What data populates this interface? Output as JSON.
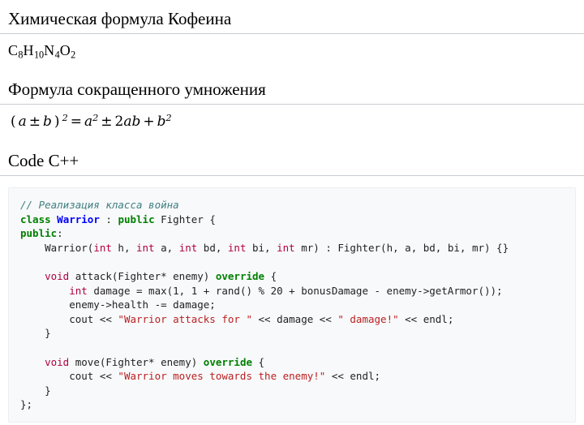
{
  "sections": {
    "chem": {
      "heading": "Химическая формула Кофеина",
      "formula_plain": "C8H10N4O2",
      "formula_parts": [
        {
          "sym": "C",
          "sub": "8"
        },
        {
          "sym": "H",
          "sub": "10"
        },
        {
          "sym": "N",
          "sub": "4"
        },
        {
          "sym": "O",
          "sub": "2"
        }
      ]
    },
    "math": {
      "heading": "Формула сокращенного умножения",
      "formula_plain": "(a ± b)² = a² ± 2ab + b²",
      "lhs_open": "(",
      "lhs_a": "a",
      "lhs_op": "±",
      "lhs_b": "b",
      "lhs_close": ")",
      "lhs_pow": "2",
      "equals": "=",
      "r_a": "a",
      "r_a_pow": "2",
      "r_op1": "±",
      "r_coef": "2",
      "r_ab": "ab",
      "r_op2": "+",
      "r_b": "b",
      "r_b_pow": "2"
    },
    "code": {
      "heading": "Code C++",
      "language": "cpp",
      "lines": [
        [
          {
            "t": "c",
            "v": "// Реализация класса война"
          }
        ],
        [
          {
            "t": "k",
            "v": "class"
          },
          {
            "t": "n",
            "v": " "
          },
          {
            "t": "nc",
            "v": "Warrior"
          },
          {
            "t": "n",
            "v": " : "
          },
          {
            "t": "k",
            "v": "public"
          },
          {
            "t": "n",
            "v": " Fighter {"
          }
        ],
        [
          {
            "t": "k",
            "v": "public"
          },
          {
            "t": "n",
            "v": ":"
          }
        ],
        [
          {
            "t": "n",
            "v": "    Warrior("
          },
          {
            "t": "kt",
            "v": "int"
          },
          {
            "t": "n",
            "v": " h, "
          },
          {
            "t": "kt",
            "v": "int"
          },
          {
            "t": "n",
            "v": " a, "
          },
          {
            "t": "kt",
            "v": "int"
          },
          {
            "t": "n",
            "v": " bd, "
          },
          {
            "t": "kt",
            "v": "int"
          },
          {
            "t": "n",
            "v": " bi, "
          },
          {
            "t": "kt",
            "v": "int"
          },
          {
            "t": "n",
            "v": " mr) : Fighter(h, a, bd, bi, mr) {}"
          }
        ],
        [
          {
            "t": "n",
            "v": ""
          }
        ],
        [
          {
            "t": "n",
            "v": "    "
          },
          {
            "t": "kt",
            "v": "void"
          },
          {
            "t": "n",
            "v": " attack(Fighter* enemy) "
          },
          {
            "t": "k",
            "v": "override"
          },
          {
            "t": "n",
            "v": " {"
          }
        ],
        [
          {
            "t": "n",
            "v": "        "
          },
          {
            "t": "kt",
            "v": "int"
          },
          {
            "t": "n",
            "v": " damage = max(1, 1 + rand() % 20 + bonusDamage - enemy->getArmor());"
          }
        ],
        [
          {
            "t": "n",
            "v": "        enemy->health -= damage;"
          }
        ],
        [
          {
            "t": "n",
            "v": "        cout << "
          },
          {
            "t": "s",
            "v": "\"Warrior attacks for \""
          },
          {
            "t": "n",
            "v": " << damage << "
          },
          {
            "t": "s",
            "v": "\" damage!\""
          },
          {
            "t": "n",
            "v": " << endl;"
          }
        ],
        [
          {
            "t": "n",
            "v": "    }"
          }
        ],
        [
          {
            "t": "n",
            "v": ""
          }
        ],
        [
          {
            "t": "n",
            "v": "    "
          },
          {
            "t": "kt",
            "v": "void"
          },
          {
            "t": "n",
            "v": " move(Fighter* enemy) "
          },
          {
            "t": "k",
            "v": "override"
          },
          {
            "t": "n",
            "v": " {"
          }
        ],
        [
          {
            "t": "n",
            "v": "        cout << "
          },
          {
            "t": "s",
            "v": "\"Warrior moves towards the enemy!\""
          },
          {
            "t": "n",
            "v": " << endl;"
          }
        ],
        [
          {
            "t": "n",
            "v": "    }"
          }
        ],
        [
          {
            "t": "n",
            "v": "};"
          }
        ]
      ]
    }
  },
  "colors": {
    "text": "#202122",
    "heading_rule": "#c8ccd1",
    "code_bg": "#f8f9fb",
    "code_border": "#eceef1",
    "token_comment": "#408080",
    "token_keyword": "#008000",
    "token_type": "#b00040",
    "token_class": "#0000ff",
    "token_string": "#ba2121"
  }
}
